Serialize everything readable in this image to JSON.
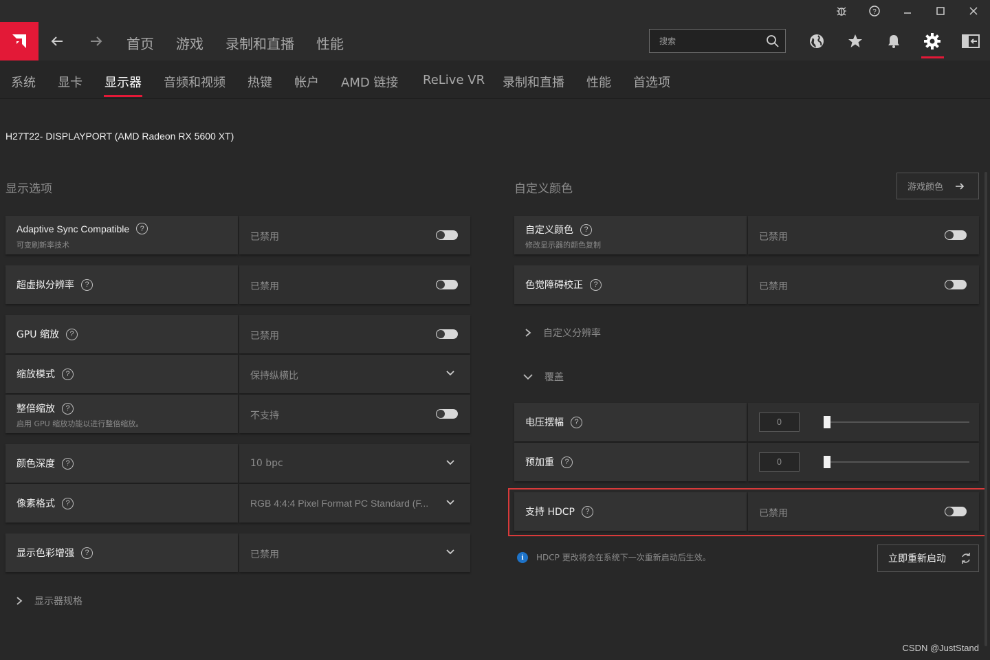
{
  "window": {
    "controls": [
      "bug-icon",
      "help-icon",
      "minimize-icon",
      "maximize-icon",
      "close-icon"
    ]
  },
  "main_nav": {
    "items": [
      "首页",
      "游戏",
      "录制和直播",
      "性能"
    ],
    "search_placeholder": "搜索"
  },
  "sub_nav": {
    "items": [
      "系统",
      "显卡",
      "显示器",
      "音频和视频",
      "热键",
      "帐户",
      "AMD 链接",
      "ReLive VR",
      "录制和直播",
      "性能",
      "首选项"
    ],
    "active": "显示器"
  },
  "monitor_title": "H27T22- DISPLAYPORT (AMD Radeon RX 5600 XT)",
  "left": {
    "section_title": "显示选项",
    "rows": [
      {
        "label": "Adaptive Sync Compatible",
        "sub": "可变刷新率技术",
        "value": "已禁用",
        "control": "toggle"
      },
      {
        "label": "超虚拟分辨率",
        "value": "已禁用",
        "control": "toggle"
      },
      {
        "label": "GPU 缩放",
        "value": "已禁用",
        "control": "toggle"
      },
      {
        "label": "缩放模式",
        "value": "保持纵横比",
        "control": "dropdown"
      },
      {
        "label": "整倍缩放",
        "sub": "启用 GPU 缩放功能以进行整倍缩放。",
        "value": "不支持",
        "control": "toggle"
      },
      {
        "label": "颜色深度",
        "value": "10 bpc",
        "control": "dropdown"
      },
      {
        "label": "像素格式",
        "value": "RGB 4:4:4 Pixel Format PC Standard (F...",
        "control": "dropdown"
      },
      {
        "label": "显示色彩增强",
        "value": "已禁用",
        "control": "dropdown"
      }
    ],
    "specs_label": "显示器规格"
  },
  "right": {
    "section_title": "自定义颜色",
    "game_color_button": "游戏颜色",
    "rows": [
      {
        "label": "自定义颜色",
        "sub": "修改显示器的颜色复制",
        "value": "已禁用",
        "control": "toggle"
      },
      {
        "label": "色觉障碍校正",
        "value": "已禁用",
        "control": "toggle"
      }
    ],
    "custom_resolution_label": "自定义分辨率",
    "overlay_label": "覆盖",
    "sliders": [
      {
        "label": "电压摆幅",
        "value": "0"
      },
      {
        "label": "预加重",
        "value": "0"
      }
    ],
    "hdcp": {
      "label": "支持 HDCP",
      "value": "已禁用"
    },
    "info_text": "HDCP 更改将会在系统下一次重新启动后生效。",
    "restart_button": "立即重新启动"
  },
  "watermark": "CSDN @JustStand",
  "colors": {
    "accent": "#e31937",
    "background": "#282828",
    "info": "#1e73c8"
  }
}
